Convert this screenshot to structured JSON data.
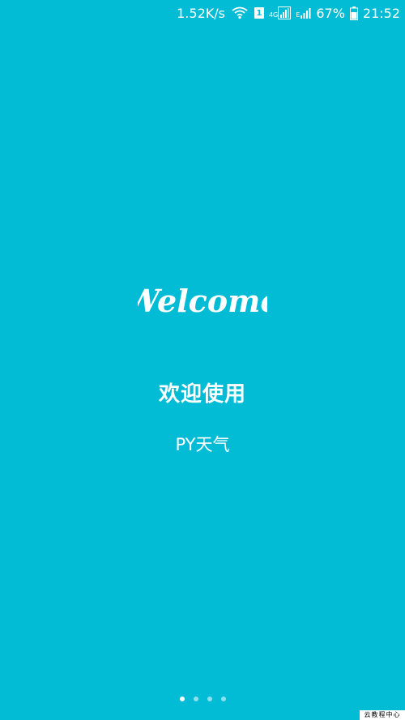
{
  "status_bar": {
    "net_speed": "1.52K/s",
    "wifi_icon": "wifi-icon",
    "sim_slot": "1",
    "sim1_network_type": "4G",
    "sim2_network_type": "E",
    "battery_percent": "67%",
    "time": "21:52"
  },
  "welcome": {
    "script_text": "Welcome",
    "title": "欢迎使用",
    "app_name": "PY天气"
  },
  "pager": {
    "page_count": 4,
    "active_index": 0
  },
  "watermark": {
    "text": "云教程中心"
  },
  "colors": {
    "background": "#02bcd6",
    "text": "#ffffff"
  }
}
